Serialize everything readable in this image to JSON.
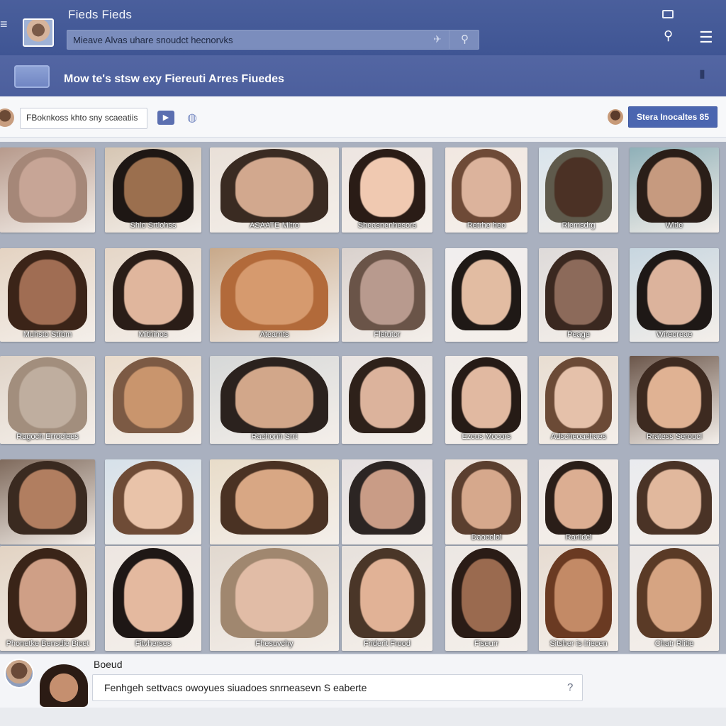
{
  "header": {
    "title": "Fieds Fieds",
    "search_value": "Mieave Alvas uhare snoudct hecnorvks",
    "icons": [
      "menu-icon",
      "avatar",
      "window-icon",
      "search-icon",
      "hamburger-icon"
    ]
  },
  "banner": {
    "text": "Mow te's stsw exy Fiereuti Arres Fiuedes"
  },
  "composer": {
    "input_value": "FBoknkoss khto sny scaeatiis",
    "share_label": "Stera Inocaltes 85"
  },
  "tiles": [
    {
      "caption": "",
      "bg": "#b79a8c",
      "face": "#c7a596",
      "hair": "#a58778"
    },
    {
      "caption": "Shio Srtlohss",
      "bg": "#d6c6b3",
      "face": "#9b6f4e",
      "hair": "#1e1714"
    },
    {
      "caption": "ASAATE Mitro",
      "bg": "#e9e0d8",
      "face": "#d2a88e",
      "hair": "#3a2b22"
    },
    {
      "caption": "Sheasnenhesors",
      "bg": "#ede5e1",
      "face": "#f0c9b1",
      "hair": "#2a1c16"
    },
    {
      "caption": "Retrhe heo",
      "bg": "#f2e8e1",
      "face": "#dcb39c",
      "hair": "#6e4a37"
    },
    {
      "caption": "Riemsdrg",
      "bg": "#d9e4ec",
      "face": "#4b3125",
      "hair": "#5f5a4c"
    },
    {
      "caption": "Witie",
      "bg": "#8fb0b8",
      "face": "#c69a7f",
      "hair": "#2a1e18"
    },
    {
      "caption": "Muhsto Strbm",
      "bg": "#e4d3c2",
      "face": "#a06d53",
      "hair": "#3b2418"
    },
    {
      "caption": "Mithihos",
      "bg": "#e5d6c7",
      "face": "#e0b69d",
      "hair": "#2a1d17"
    },
    {
      "caption": "Atearnts",
      "bg": "#c8a98a",
      "face": "#d69a6e",
      "hair": "#b26a3a"
    },
    {
      "caption": "Fletutor",
      "bg": "#d9d1cd",
      "face": "#b89a8e",
      "hair": "#6a5448"
    },
    {
      "caption": "",
      "bg": "#f1eeee",
      "face": "#e2bca2",
      "hair": "#1f1916"
    },
    {
      "caption": "Peage",
      "bg": "#dedad9",
      "face": "#8c6a5a",
      "hair": "#3a2820"
    },
    {
      "caption": "Wireoreae",
      "bg": "#c7d6e0",
      "face": "#dcb39c",
      "hair": "#1e1816"
    },
    {
      "caption": "Ragoch Erroclees",
      "bg": "#e0d4c8",
      "face": "#bfae9f",
      "hair": "#a28e7d"
    },
    {
      "caption": "",
      "bg": "#eadccc",
      "face": "#c9956d",
      "hair": "#7c5a44"
    },
    {
      "caption": "Rachonh Srrt",
      "bg": "#d6d8d8",
      "face": "#d2a78a",
      "hair": "#2b221e"
    },
    {
      "caption": "",
      "bg": "#e9e4e2",
      "face": "#dcb39c",
      "hair": "#2e211a"
    },
    {
      "caption": "Ezcus Mocors",
      "bg": "#f0ebe8",
      "face": "#e1b9a1",
      "hair": "#261b16"
    },
    {
      "caption": "Adscheoachaes",
      "bg": "#e8ddd1",
      "face": "#e5c1aa",
      "hair": "#6b4a36"
    },
    {
      "caption": "Rratess Seroucl",
      "bg": "#6b564a",
      "face": "#e0b293",
      "hair": "#3d2a20"
    },
    {
      "caption": "",
      "bg": "#7f6a5c",
      "face": "#b17e60",
      "hair": "#3a2a20"
    },
    {
      "caption": "",
      "bg": "#d6e1ea",
      "face": "#e9c3a9",
      "hair": "#6e4b36"
    },
    {
      "caption": "",
      "bg": "#e8dcc9",
      "face": "#d8a784",
      "hair": "#4a3223"
    },
    {
      "caption": "",
      "bg": "#e4dfe0",
      "face": "#c99c86",
      "hair": "#2c2523"
    },
    {
      "caption": "Daocolol",
      "bg": "#ece3dc",
      "face": "#d6a88c",
      "hair": "#5b3f2f"
    },
    {
      "caption": "Rariidcl",
      "bg": "#eee8e4",
      "face": "#dcae92",
      "hair": "#2a1e18"
    },
    {
      "caption": "",
      "bg": "#eaebef",
      "face": "#e1b89d",
      "hair": "#4a3326"
    },
    {
      "caption": "Phonetke Bensdie Bicet",
      "bg": "#e2d3c3",
      "face": "#cf9f86",
      "hair": "#3a2418"
    },
    {
      "caption": "Fitvherses",
      "bg": "#ede6e1",
      "face": "#e4b99f",
      "hair": "#1e1715"
    },
    {
      "caption": "Fhesuvchy",
      "bg": "#e1d8cf",
      "face": "#e1bca6",
      "hair": "#a0876f"
    },
    {
      "caption": "Friderit Frood",
      "bg": "#e7e1dc",
      "face": "#e1b296",
      "hair": "#4a3628"
    },
    {
      "caption": "Fiseurr",
      "bg": "#ece7e3",
      "face": "#9a6a4f",
      "hair": "#2a1c16"
    },
    {
      "caption": "Sitsher is Iriecen",
      "bg": "#e6dbd1",
      "face": "#c38a66",
      "hair": "#6a3a22"
    },
    {
      "caption": "Chatr Rlitie",
      "bg": "#ebe7e5",
      "face": "#d6a482",
      "hair": "#5a3a26"
    }
  ],
  "bottom": {
    "label": "Boeud",
    "input_value": "Fenhgeh settvacs owoyues siuadoes snrneasevn S eaberte",
    "help": "?"
  }
}
